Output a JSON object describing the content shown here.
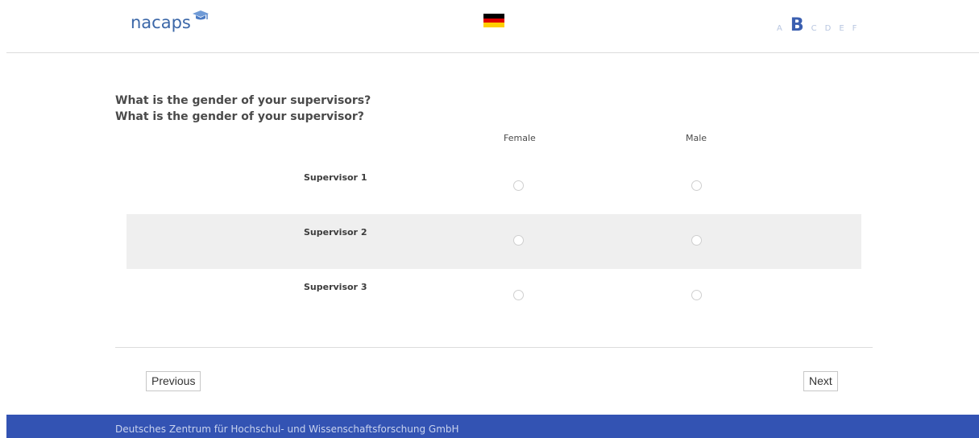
{
  "header": {
    "logo_text": "nacaps",
    "sections": [
      "A",
      "B",
      "C",
      "D",
      "E",
      "F"
    ],
    "active_section": "B",
    "flag_colors": [
      "#000000",
      "#dd0000",
      "#ffce00"
    ],
    "brand_color": "#3b67a8"
  },
  "question": {
    "line1": "What is the gender of your supervisors?",
    "line2": "What is the gender of your supervisor?",
    "columns": [
      "Female",
      "Male"
    ],
    "rows": [
      {
        "label": "Supervisor 1"
      },
      {
        "label": "Supervisor 2"
      },
      {
        "label": "Supervisor 3"
      }
    ]
  },
  "navigation": {
    "previous_label": "Previous",
    "next_label": "Next"
  },
  "footer": {
    "text": "Deutsches Zentrum für Hochschul- und Wissenschaftsforschung GmbH",
    "color": "#3353b3"
  }
}
